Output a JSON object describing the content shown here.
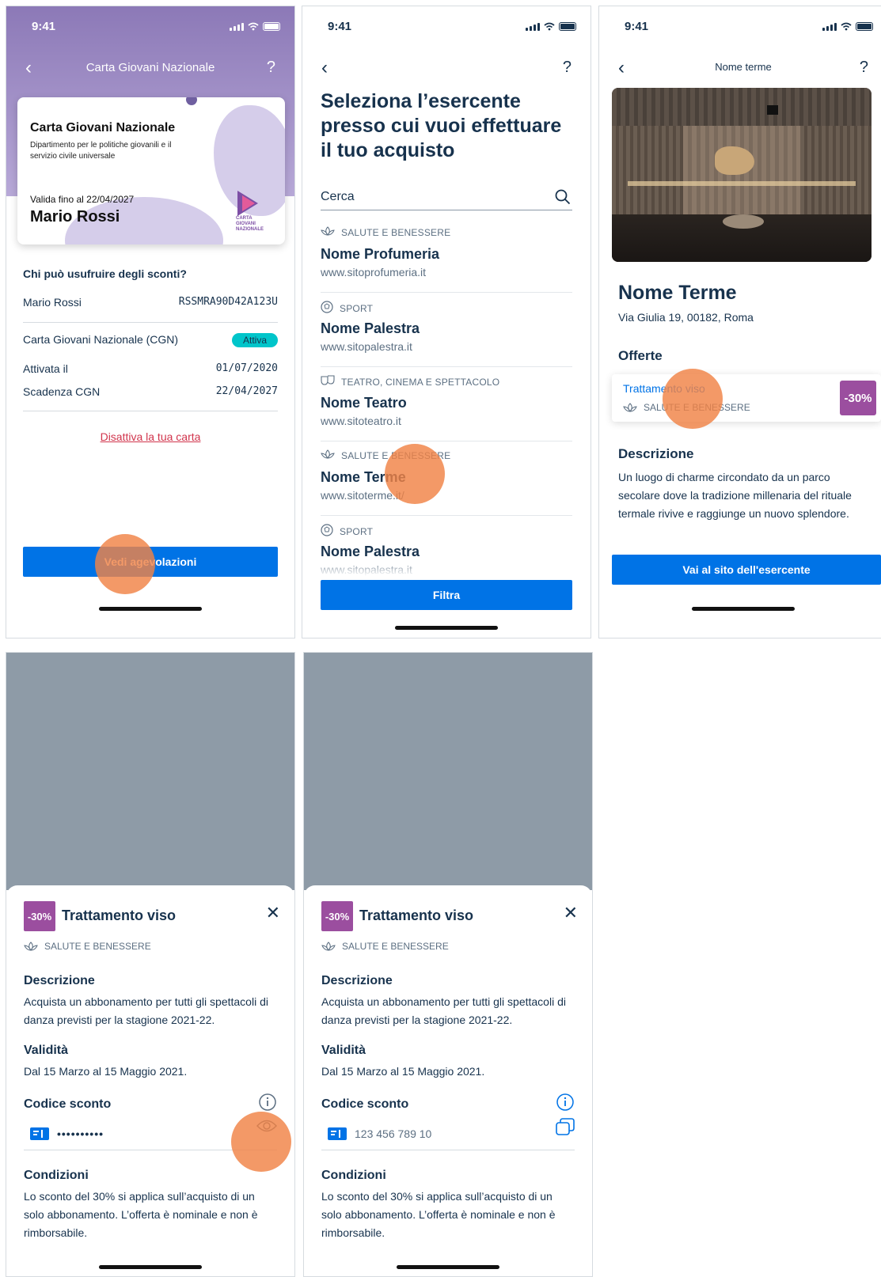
{
  "status": {
    "time": "9:41"
  },
  "screen1": {
    "nav_title": "Carta Giovani Nazionale",
    "back": "‹",
    "help": "?",
    "card": {
      "name": "Carta Giovani Nazionale",
      "subtitle": "Dipartimento per le politiche giovanili e il servizio civile universale",
      "valid_until": "Valida fino al 22/04/2027",
      "holder": "Mario Rossi",
      "logo_text": "CARTA GIOVANI NAZIONALE"
    },
    "who_title": "Chi può usufruire degli sconti?",
    "owner_name": "Mario Rossi",
    "fiscal_code": "RSSMRA90D42A123U",
    "cgn_label": "Carta Giovani Nazionale (CGN)",
    "status_badge": "Attiva",
    "activated_label": "Attivata il",
    "activated_value": "01/07/2020",
    "expiry_label": "Scadenza CGN",
    "expiry_value": "22/04/2027",
    "deactivate_link": "Disattiva la tua carta",
    "cta": "Vedi agevolazioni"
  },
  "screen2": {
    "back": "‹",
    "help": "?",
    "heading": "Seleziona l’esercente presso cui vuoi effettuare il tuo acquisto",
    "search_placeholder": "Cerca",
    "merchants": [
      {
        "category": "SALUTE E BENESSERE",
        "name": "Nome Profumeria",
        "url": "www.sitoprofumeria.it",
        "icon": "lotus-icon"
      },
      {
        "category": "SPORT",
        "name": "Nome Palestra",
        "url": "www.sitopalestra.it",
        "icon": "ball-icon"
      },
      {
        "category": "TEATRO, CINEMA E SPETTACOLO",
        "name": "Nome Teatro",
        "url": "www.sitoteatro.it",
        "icon": "masks-icon"
      },
      {
        "category": "SALUTE E BENESSERE",
        "name": "Nome Terme",
        "url": "www.sitoterme.it/",
        "icon": "lotus-icon"
      },
      {
        "category": "SPORT",
        "name": "Nome Palestra",
        "url": "www.sitopalestra.it",
        "icon": "ball-icon"
      }
    ],
    "filter_button": "Filtra"
  },
  "screen3": {
    "back": "‹",
    "help": "?",
    "nav_title": "Nome terme",
    "place_name": "Nome Terme",
    "address": "Via Giulia 19, 00182, Roma",
    "offers_heading": "Offerte",
    "offer": {
      "title": "Trattamento viso",
      "category": "SALUTE E BENESSERE",
      "discount": "-30%"
    },
    "description_heading": "Descrizione",
    "description": "Un luogo di charme circondato da un parco secolare dove la tradizione millenaria del rituale termale rivive e raggiunge un nuovo splendore.",
    "cta": "Vai al sito dell'esercente"
  },
  "sheet": {
    "discount": "-30%",
    "title": "Trattamento viso",
    "close": "✕",
    "category": "SALUTE E BENESSERE",
    "description_heading": "Descrizione",
    "description": "Acquista un abbonamento per tutti gli spettacoli di danza previsti per la stagione 2021-22.",
    "validity_heading": "Validità",
    "validity": "Dal 15 Marzo al 15 Maggio 2021.",
    "code_heading": "Codice sconto",
    "conditions_heading": "Condizioni",
    "conditions": "Lo sconto del 30% si applica sull’acquisto di un solo abbonamento. L’offerta è nominale e non è rimborsabile."
  },
  "screen4": {
    "code_masked": "••••••••••"
  },
  "screen5": {
    "code_visible": "123 456 789 10"
  },
  "colors": {
    "primary": "#0073e6",
    "purple": "#9b4e9f",
    "teal": "#00c5ca",
    "danger": "#d1344c",
    "text": "#17324d"
  }
}
